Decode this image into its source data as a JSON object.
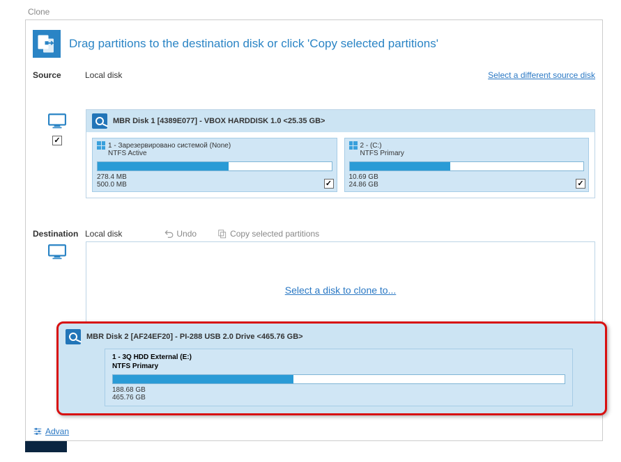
{
  "window_title": "Clone",
  "header_title": "Drag partitions to the destination disk or click 'Copy selected partitions'",
  "source": {
    "label": "Source",
    "value": "Local disk",
    "select_different": "Select a different source disk",
    "disk_title": "MBR Disk 1 [4389E077] - VBOX HARDDISK 1.0  <25.35 GB>",
    "partitions": [
      {
        "name": "1 - Зарезервировано системой (None)",
        "fs": "NTFS Active",
        "used": "278.4 MB",
        "total": "500.0 MB",
        "fill_pct": 56,
        "checked": true
      },
      {
        "name": "2 -  (C:)",
        "fs": "NTFS Primary",
        "used": "10.69 GB",
        "total": "24.86 GB",
        "fill_pct": 43,
        "checked": true
      }
    ]
  },
  "destination": {
    "label": "Destination",
    "value": "Local disk",
    "undo": "Undo",
    "copy": "Copy selected partitions",
    "select_link": "Select a disk to clone to..."
  },
  "popup": {
    "disk_title": "MBR Disk 2 [AF24EF20] - PI-288   USB 2.0 Drive  <465.76 GB>",
    "partition": {
      "name": "1 - 3Q HDD External (E:)",
      "fs": "NTFS Primary",
      "used": "188.68 GB",
      "total": "465.76 GB",
      "fill_pct": 40
    }
  },
  "advanced": "Advan"
}
